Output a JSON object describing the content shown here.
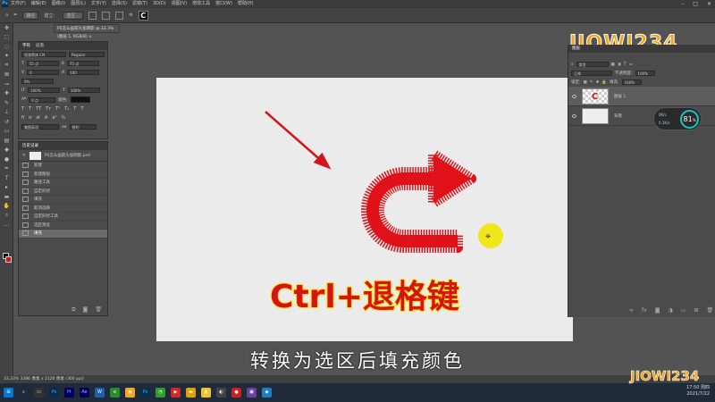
{
  "app": {
    "logo": "Ps"
  },
  "menu": [
    "文件(F)",
    "编辑(E)",
    "图像(I)",
    "图层(L)",
    "文字(Y)",
    "选择(S)",
    "滤镜(T)",
    "3D(D)",
    "视图(V)",
    "增效工具",
    "窗口(W)",
    "帮助(H)"
  ],
  "window_controls": [
    "–",
    "□",
    "✕"
  ],
  "options": {
    "mode": "路径",
    "op": "建立：",
    "opt2": "选区..."
  },
  "doc_tab": "PS怎么画箭头加阴影 @ 33.3% (图层 1, RGB/8) ×",
  "char_panel": {
    "tabs": [
      "字符",
      "段落"
    ],
    "font": "思源黑体 CN",
    "style": "Regular",
    "size": "55 点",
    "leading": "75 点",
    "kerning": "0",
    "tracking": "100",
    "scale_v": "100%",
    "scale_h": "100%",
    "baseline": "0 点",
    "color_label": "颜色:",
    "lang": "美国英语",
    "aa": "锐利"
  },
  "history_panel": {
    "title": "历史记录",
    "snapshot": "PS怎么画箭头加阴影.psd",
    "items": [
      "新建",
      "新建图层",
      "路径工具",
      "自定形状",
      "填充",
      "取消选择",
      "自定形状工具",
      "选区预览",
      "填充"
    ]
  },
  "layers_panel": {
    "title": "图层",
    "kind": "类型",
    "blend": "正常",
    "opacity_label": "不透明度:",
    "opacity": "100%",
    "lock_label": "锁定:",
    "fill_label": "填充:",
    "fill": "100%",
    "layers": [
      {
        "name": "图层 1",
        "selected": true
      },
      {
        "name": "背景",
        "selected": false
      }
    ]
  },
  "hud": {
    "value": "81",
    "unit": "%",
    "up": "0K/s",
    "down": "0.1K/s"
  },
  "caption": "Ctrl+退格键",
  "subtitle": "转换为选区后填充颜色",
  "status": "33.33%    3386 像素 x 2126 像素 (300 ppi)",
  "clock": {
    "time": "17:50 周四",
    "date": "2021/7/22"
  },
  "logo": "JIOWI234",
  "colors": {
    "arrow": "#e01118",
    "cursor": "#f0e61a",
    "accent": "#18c3c9"
  }
}
